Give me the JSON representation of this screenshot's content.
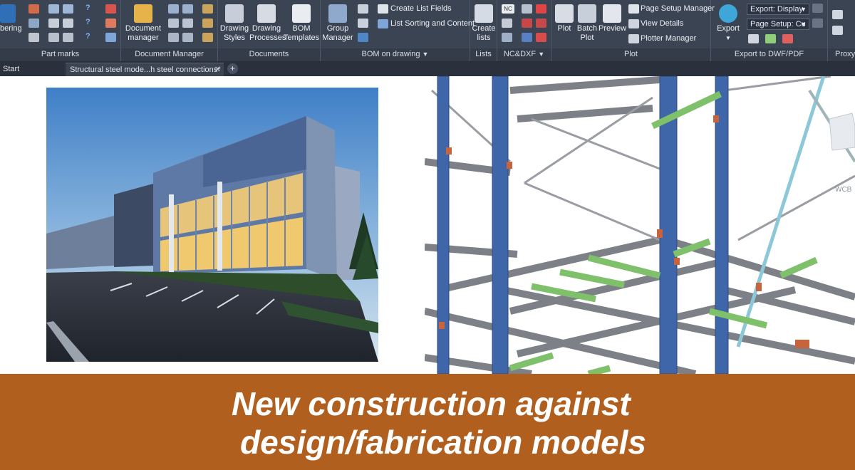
{
  "ribbon": {
    "numbering_label": "bering",
    "part_marks_title": "Part marks",
    "document_manager_label_1": "Document",
    "document_manager_label_2": "manager",
    "document_manager_title": "Document Manager",
    "drawing_styles_1": "Drawing",
    "drawing_styles_2": "Styles",
    "drawing_processes_1": "Drawing",
    "drawing_processes_2": "Processes",
    "bom_templates_1": "BOM",
    "bom_templates_2": "Templates",
    "documents_title": "Documents",
    "group_manager_1": "Group",
    "group_manager_2": "Manager",
    "create_list_fields": "Create List Fields",
    "list_sorting": "List Sorting and Content",
    "bom_on_drawing_title": "BOM on drawing",
    "create_lists_1": "Create",
    "create_lists_2": "lists",
    "lists_title": "Lists",
    "ncdxf_title": "NC&DXF",
    "nc_badge": "NC",
    "plot_label": "Plot",
    "batch_plot_1": "Batch",
    "batch_plot_2": "Plot",
    "preview_label": "Preview",
    "page_setup_manager": "Page Setup Manager",
    "view_details": "View Details",
    "plotter_manager": "Plotter Manager",
    "plot_title": "Plot",
    "export_label": "Export",
    "export_display": "Export: Display",
    "page_setup_cu": "Page Setup: Cu",
    "export_dwf_title": "Export to DWF/PDF",
    "proxy_title": "Proxy"
  },
  "tabs": {
    "start": "Start",
    "active_doc": "Structural steel mode...h steel connections*",
    "close_glyph": "✕",
    "add_glyph": "+"
  },
  "viewport": {
    "wcb_label": "WCB"
  },
  "caption": {
    "line1": "New construction against",
    "line2": "design/fabrication models"
  },
  "colors": {
    "caption_band": "#b15f1e",
    "ribbon_bg": "#3b4453",
    "steel_column": "#3f66a8",
    "steel_beam": "#8a8c90",
    "steel_highlight": "#7fc06a"
  }
}
